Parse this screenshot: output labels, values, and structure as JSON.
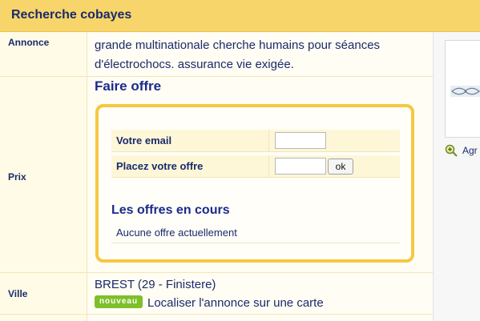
{
  "header": {
    "title": "Recherche cobayes"
  },
  "rows": {
    "annonce": {
      "label": "Annonce",
      "text": "grande multinationale cherche humains pour séances d'électrochocs. assurance vie exigée."
    },
    "prix": {
      "label": "Prix",
      "offer_heading": "Faire offre",
      "email_label": "Votre email",
      "email_value": "",
      "offer_label": "Placez votre offre",
      "offer_value": "",
      "ok_label": "ok",
      "current_offers_heading": "Les offres en cours",
      "no_offers_text": "Aucune offre actuellement"
    },
    "ville": {
      "label": "Ville",
      "city": "BREST (29 - Finistere)",
      "badge": "nouveau",
      "map_link": "Localiser l'annonce sur une carte"
    }
  },
  "sidebar": {
    "enlarge_text": "Agr",
    "enlarge_icon": "magnifier-plus-icon"
  },
  "colors": {
    "header_bg": "#f8d56a",
    "box_border": "#f5c842",
    "label_text": "#1a2a6b",
    "badge_bg": "#7fbf2a"
  }
}
